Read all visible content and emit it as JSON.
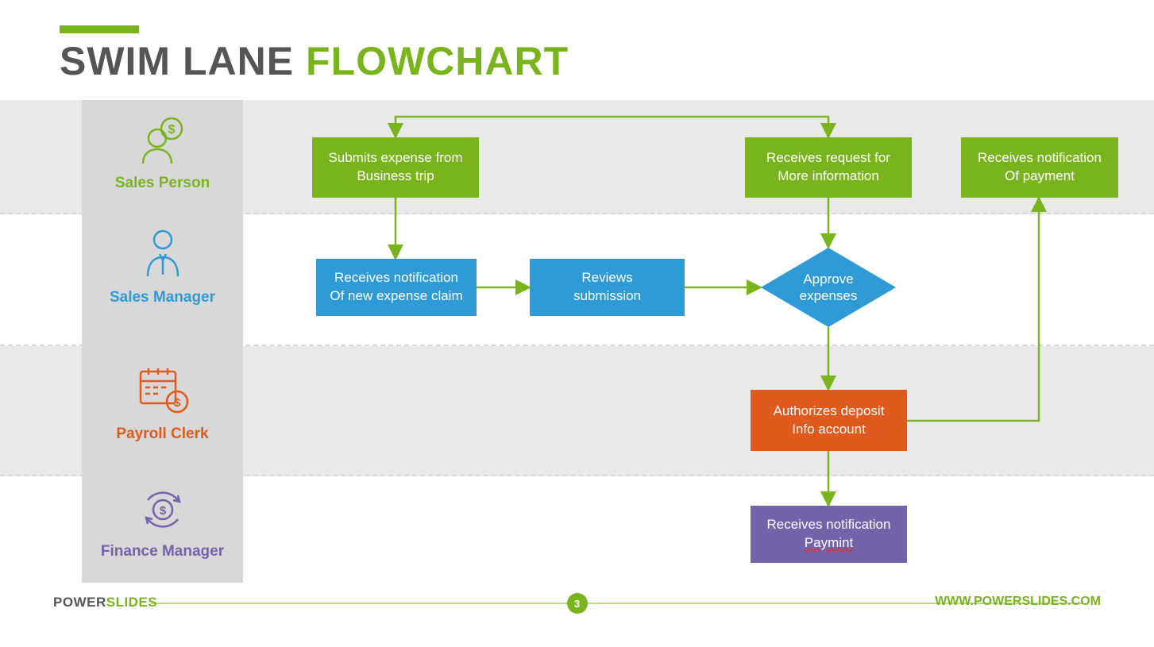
{
  "title": {
    "part1": "SWIM LANE ",
    "part2": "FLOWCHART"
  },
  "lanes": {
    "salesPerson": {
      "label": "Sales Person",
      "color": "#7AB41D"
    },
    "salesManager": {
      "label": "Sales Manager",
      "color": "#2E9BD6"
    },
    "payrollClerk": {
      "label": "Payroll Clerk",
      "color": "#E15A1D"
    },
    "financeManager": {
      "label": "Finance Manager",
      "color": "#7363AA"
    }
  },
  "boxes": {
    "submitExpense": {
      "l1": "Submits expense from",
      "l2": "Business trip"
    },
    "receiveRequest": {
      "l1": "Receives request for",
      "l2": "More information"
    },
    "receivePaymentNotif": {
      "l1": "Receives notification",
      "l2": "Of payment"
    },
    "receiveNewClaim": {
      "l1": "Receives notification",
      "l2": "Of new expense claim"
    },
    "reviewSubmission": {
      "l1": "Reviews",
      "l2": "submission"
    },
    "approveExpenses": {
      "l1": "Approve",
      "l2": "expenses"
    },
    "authorizeDeposit": {
      "l1": "Authorizes deposit",
      "l2": "Info account"
    },
    "receivePaymint": {
      "l1": "Receives notification",
      "l2": "Paymint"
    }
  },
  "footer": {
    "brandLeft1": "POWER",
    "brandLeft2": "SLIDES",
    "pageNumber": "3",
    "url": "WWW.POWERSLIDES.COM"
  },
  "colors": {
    "green": "#7AB41D",
    "blue": "#2E9BD6",
    "orange": "#E15A1D",
    "purple": "#7363AA",
    "grayDark": "#555555",
    "grayLight": "#e9e9e9"
  }
}
